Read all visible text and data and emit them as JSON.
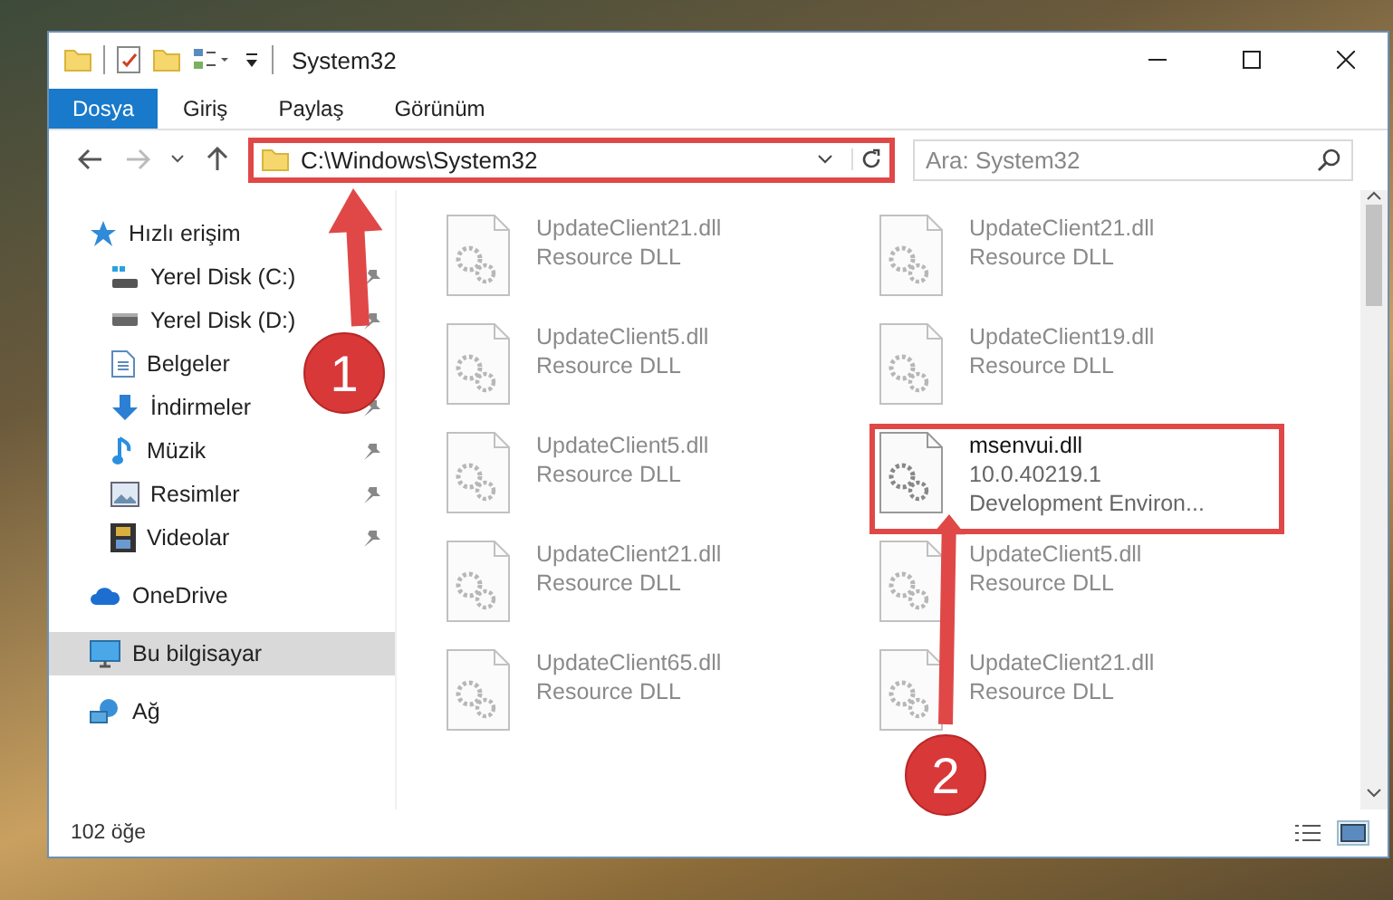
{
  "window": {
    "title": "System32"
  },
  "ribbon": {
    "tabs": [
      {
        "label": "Dosya",
        "selected": true
      },
      {
        "label": "Giriş",
        "selected": false
      },
      {
        "label": "Paylaş",
        "selected": false
      },
      {
        "label": "Görünüm",
        "selected": false
      }
    ]
  },
  "address_bar": {
    "path": "C:\\Windows\\System32",
    "highlighted": true
  },
  "search": {
    "placeholder": "Ara: System32"
  },
  "navigation": [
    {
      "label": "Hızlı erişim",
      "kind": "star",
      "selected": false,
      "children": [
        {
          "label": "Yerel Disk (C:)",
          "kind": "system-drive",
          "pinned": true,
          "selected": false
        },
        {
          "label": "Yerel Disk (D:)",
          "kind": "drive",
          "pinned": true,
          "selected": false
        },
        {
          "label": "Belgeler",
          "kind": "document",
          "selected": false
        },
        {
          "label": "İndirmeler",
          "kind": "download",
          "pinned": true,
          "selected": false
        },
        {
          "label": "Müzik",
          "kind": "music",
          "pinned": true,
          "selected": false
        },
        {
          "label": "Resimler",
          "kind": "picture",
          "pinned": true,
          "selected": false
        },
        {
          "label": "Videolar",
          "kind": "video",
          "pinned": true,
          "selected": false
        }
      ]
    },
    {
      "label": "OneDrive",
      "kind": "cloud",
      "selected": false
    },
    {
      "label": "Bu bilgisayar",
      "kind": "computer",
      "selected": true
    },
    {
      "label": "Ağ",
      "kind": "network",
      "selected": false
    }
  ],
  "files": [
    {
      "name": "UpdateClient21.dll",
      "details": [
        "Resource DLL"
      ],
      "blurred": true,
      "highlighted": false
    },
    {
      "name": "UpdateClient21.dll",
      "details": [
        "Resource DLL"
      ],
      "blurred": true,
      "highlighted": false
    },
    {
      "name": "UpdateClient5.dll",
      "details": [
        "Resource DLL"
      ],
      "blurred": true,
      "highlighted": false
    },
    {
      "name": "UpdateClient19.dll",
      "details": [
        "Resource DLL"
      ],
      "blurred": true,
      "highlighted": false
    },
    {
      "name": "UpdateClient5.dll",
      "details": [
        "Resource DLL"
      ],
      "blurred": true,
      "highlighted": false
    },
    {
      "name": "msenvui.dll",
      "details": [
        "10.0.40219.1",
        "Development Environ..."
      ],
      "blurred": false,
      "highlighted": true
    },
    {
      "name": "UpdateClient21.dll",
      "details": [
        "Resource DLL"
      ],
      "blurred": true,
      "highlighted": false
    },
    {
      "name": "UpdateClient5.dll",
      "details": [
        "Resource DLL"
      ],
      "blurred": true,
      "highlighted": false
    },
    {
      "name": "UpdateClient65.dll",
      "details": [
        "Resource DLL"
      ],
      "blurred": true,
      "highlighted": false
    },
    {
      "name": "UpdateClient21.dll",
      "details": [
        "Resource DLL"
      ],
      "blurred": true,
      "highlighted": false
    }
  ],
  "status_bar": {
    "item_count": "102 öğe"
  },
  "annotations": [
    {
      "label": "1"
    },
    {
      "label": "2"
    }
  ]
}
